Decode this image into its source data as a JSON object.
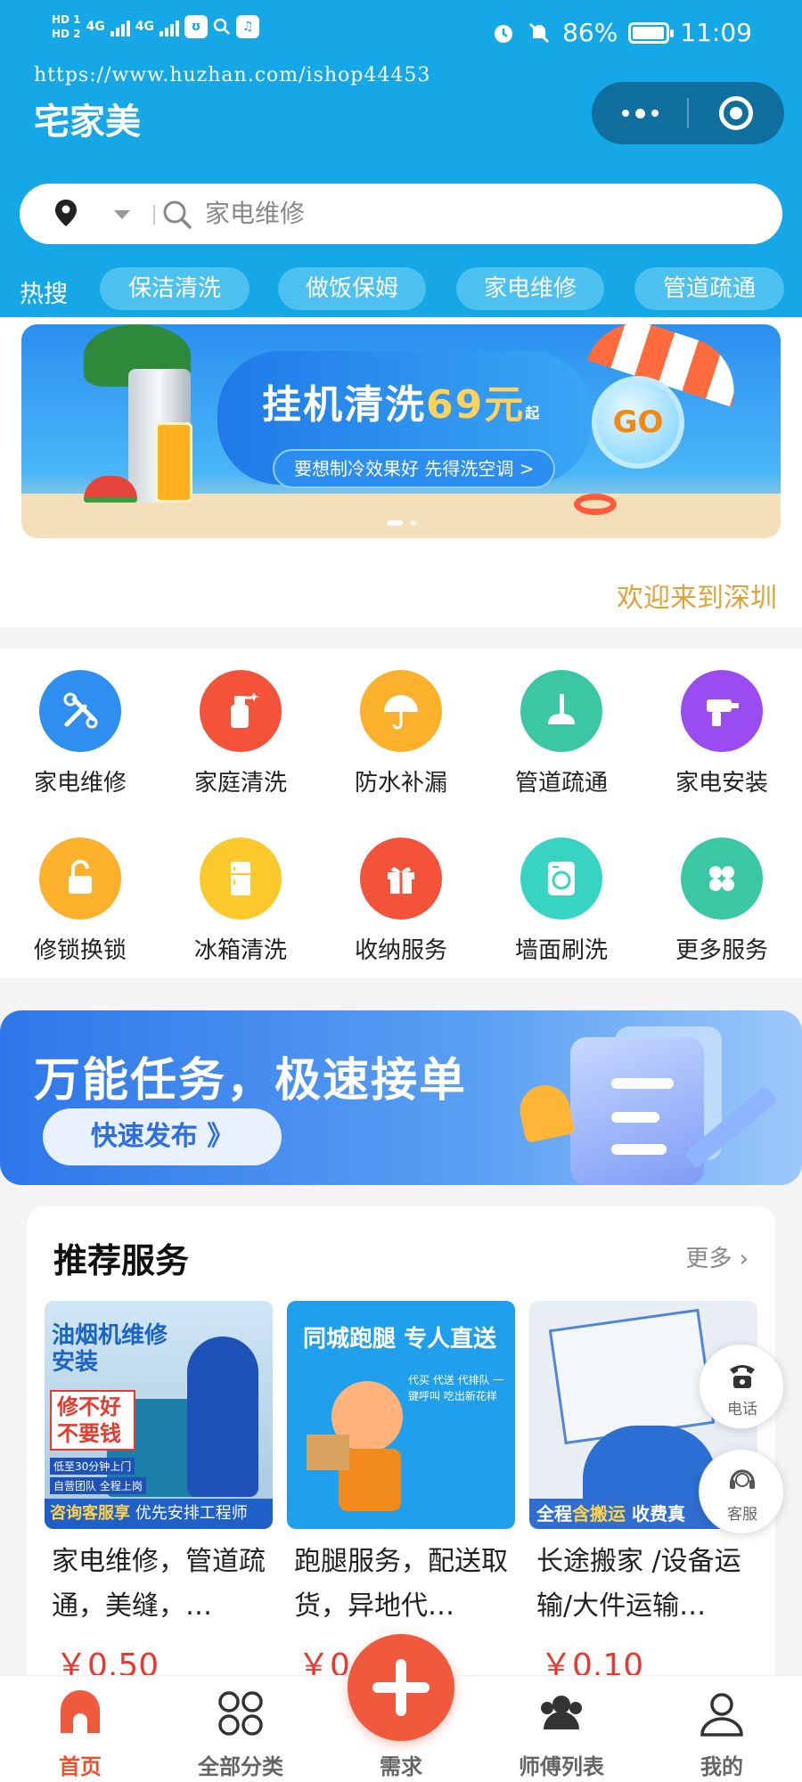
{
  "status_bar": {
    "hd1": "HD 1",
    "hd2": "HD 2",
    "net1": "4G",
    "net2": "4G",
    "battery": "86%",
    "time": "11:09"
  },
  "watermark": "https://www.huzhan.com/ishop44453",
  "app_title": "宅家美",
  "search": {
    "placeholder": "家电维修"
  },
  "hot_search": {
    "label": "热搜",
    "tags": [
      "保洁清洗",
      "做饭保姆",
      "家电维修",
      "管道疏通"
    ]
  },
  "banner": {
    "title_prefix": "挂机清洗",
    "price": "69元",
    "qi": "起",
    "subtitle": "要想制冷效果好 先得洗空调 >",
    "go": "GO"
  },
  "marquee": "欢迎来到深圳",
  "services": [
    {
      "label": "家电维修",
      "icon": "tools-icon",
      "color": "#2f8ff0"
    },
    {
      "label": "家庭清洗",
      "icon": "spray-bottle-icon",
      "color": "#f4533a"
    },
    {
      "label": "防水补漏",
      "icon": "umbrella-icon",
      "color": "#fbb12b"
    },
    {
      "label": "管道疏通",
      "icon": "plunger-icon",
      "color": "#3cc7a4"
    },
    {
      "label": "家电安装",
      "icon": "drill-icon",
      "color": "#9a4cf0"
    },
    {
      "label": "修锁换锁",
      "icon": "unlock-icon",
      "color": "#fbb12b"
    },
    {
      "label": "冰箱清洗",
      "icon": "fridge-icon",
      "color": "#fcc92c"
    },
    {
      "label": "收纳服务",
      "icon": "gift-box-icon",
      "color": "#f4533a"
    },
    {
      "label": "墙面刷洗",
      "icon": "washing-machine-icon",
      "color": "#37d3c3"
    },
    {
      "label": "更多服务",
      "icon": "more-grid-icon",
      "color": "#3cc7a4"
    }
  ],
  "promo": {
    "title": "万能任务，极速接单",
    "button": "快速发布 》"
  },
  "recommend": {
    "title": "推荐服务",
    "more": "更多",
    "cards": [
      {
        "name": "家电维修，管道疏通，美缝，…",
        "price": "￥0.50",
        "img_title": "油烟机维修安装",
        "img_tag": "修不好 不要钱",
        "img_line1": "低至30分钟上门",
        "img_line2": "自营团队 全程上岗",
        "img_bar_a": "咨询客服享",
        "img_bar_b": "优先安排工程师"
      },
      {
        "name": "跑腿服务，配送取货，异地代…",
        "price": "￥0.",
        "img_title": "同城跑腿 专人直送",
        "img_text": "代买 代送 代排队 一键呼叫 吃出新花样"
      },
      {
        "name": "长途搬家 /设备运输/大件运输…",
        "price": "￥0.10",
        "img_bar_a": "全程",
        "img_bar_b": "含搬运",
        "img_bar_c": "收费真"
      }
    ]
  },
  "float": {
    "phone": "电话",
    "service": "客服"
  },
  "tabbar": {
    "home": "首页",
    "category": "全部分类",
    "demand": "需求",
    "masters": "师傅列表",
    "mine": "我的"
  },
  "colors": {
    "header": "#15a7e6",
    "accent": "#e8502f",
    "price": "#e8392e"
  }
}
